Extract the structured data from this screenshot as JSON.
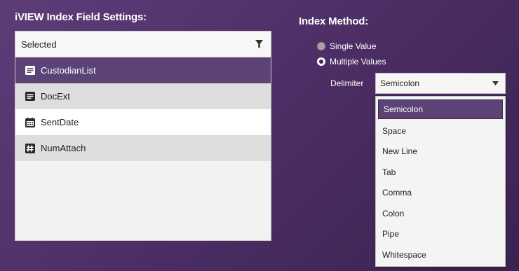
{
  "left_panel": {
    "title": "iVIEW Index Field Settings:",
    "list_header": "Selected",
    "fields": [
      {
        "label": "CustodianList",
        "icon": "text-field-icon",
        "state": "selected"
      },
      {
        "label": "DocExt",
        "icon": "text-field-icon",
        "state": "alt"
      },
      {
        "label": "SentDate",
        "icon": "calendar-icon",
        "state": "white"
      },
      {
        "label": "NumAttach",
        "icon": "number-field-icon",
        "state": "alt"
      }
    ]
  },
  "right_panel": {
    "title": "Index Method:",
    "options": [
      {
        "label": "Single Value",
        "checked": false
      },
      {
        "label": "Multiple Values",
        "checked": true
      }
    ],
    "delimiter_label": "Delimiter",
    "delimiter_value": "Semicolon",
    "delimiter_options": [
      "Semicolon",
      "Space",
      "New Line",
      "Tab",
      "Comma",
      "Colon",
      "Pipe",
      "Whitespace"
    ]
  },
  "colors": {
    "background": "#4e2f67",
    "selection": "#5b4376",
    "list_bg": "#f2f2f2"
  }
}
